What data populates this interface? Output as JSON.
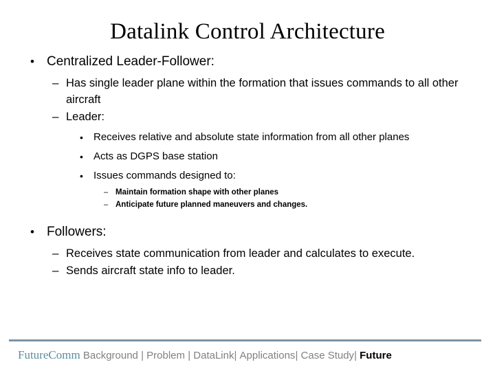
{
  "slide": {
    "title": "Datalink Control Architecture",
    "bullets": [
      {
        "level": 1,
        "marker": "•",
        "text": "Centralized Leader-Follower:"
      },
      {
        "level": 2,
        "marker": "–",
        "text": "Has single leader plane within the formation that issues commands to all other aircraft"
      },
      {
        "level": 2,
        "marker": "–",
        "text": "Leader:"
      },
      {
        "level": 3,
        "marker": "•",
        "text": "Receives relative and absolute state information from all other planes"
      },
      {
        "level": 3,
        "marker": "•",
        "text": "Acts as DGPS base station"
      },
      {
        "level": 3,
        "marker": "•",
        "text": "Issues commands designed to:"
      },
      {
        "level": 4,
        "marker": "–",
        "text": "Maintain formation shape with other planes"
      },
      {
        "level": 4,
        "marker": "–",
        "text": "Anticipate future planned maneuvers and changes."
      },
      {
        "level": 1,
        "marker": "•",
        "text": "Followers:"
      },
      {
        "level": 2,
        "marker": "–",
        "text": "Receives state communication from leader and calculates to execute."
      },
      {
        "level": 2,
        "marker": "–",
        "text": "Sends aircraft state info to leader."
      }
    ]
  },
  "footer": {
    "brand": "FutureComm",
    "separator": "|",
    "nav": [
      {
        "label": "Background",
        "current": false
      },
      {
        "label": "Problem",
        "current": false
      },
      {
        "label": "DataLink",
        "current": false
      },
      {
        "label": "Applications",
        "current": false
      },
      {
        "label": "Case Study",
        "current": false
      },
      {
        "label": "Future",
        "current": true
      }
    ],
    "colors": {
      "brand": "#5b8ca0",
      "nav": "#808080",
      "current": "#000000",
      "rule": "#7b93a6"
    }
  }
}
